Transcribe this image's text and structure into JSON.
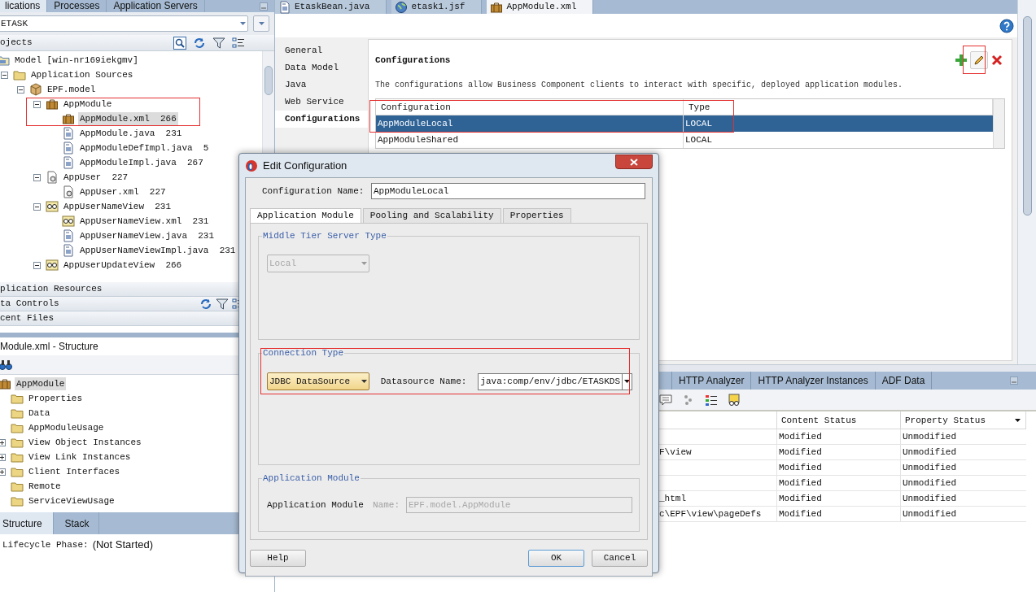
{
  "left_tabs": [
    {
      "label": "lications",
      "selected": true
    },
    {
      "label": "Processes",
      "selected": false
    },
    {
      "label": "Application Servers",
      "selected": false
    }
  ],
  "app_selector": {
    "value": "ETASK"
  },
  "projects_header": {
    "title": "ojects"
  },
  "project_tree": [
    {
      "label": "Model [win-nr169iekgmv]",
      "kind": "project",
      "selected": false,
      "children": [
        {
          "label": "Application Sources",
          "kind": "folder",
          "selected": false,
          "expanded": true,
          "children": [
            {
              "label": "EPF.model",
              "kind": "package",
              "selected": false,
              "expanded": true,
              "children": [
                {
                  "label": "AppModule",
                  "kind": "module",
                  "selected": false,
                  "expanded": true,
                  "children": [
                    {
                      "label": "AppModule.xml",
                      "count": "266",
                      "kind": "module",
                      "selected": true
                    },
                    {
                      "label": "AppModule.java",
                      "count": "231",
                      "kind": "java",
                      "selected": false
                    },
                    {
                      "label": "AppModuleDefImpl.java",
                      "count": "5",
                      "kind": "java",
                      "selected": false
                    },
                    {
                      "label": "AppModuleImpl.java",
                      "count": "267",
                      "kind": "java",
                      "selected": false
                    }
                  ]
                },
                {
                  "label": "AppUser",
                  "count": "227",
                  "kind": "entity",
                  "selected": false,
                  "expanded": true,
                  "children": [
                    {
                      "label": "AppUser.xml",
                      "count": "227",
                      "kind": "entity",
                      "selected": false
                    }
                  ]
                },
                {
                  "label": "AppUserNameView",
                  "count": "231",
                  "kind": "view",
                  "selected": false,
                  "expanded": true,
                  "children": [
                    {
                      "label": "AppUserNameView.xml",
                      "count": "231",
                      "kind": "view",
                      "selected": false
                    },
                    {
                      "label": "AppUserNameView.java",
                      "count": "231",
                      "kind": "java",
                      "selected": false
                    },
                    {
                      "label": "AppUserNameViewImpl.java",
                      "count": "231",
                      "kind": "java",
                      "selected": false
                    }
                  ]
                },
                {
                  "label": "AppUserUpdateView",
                  "count": "266",
                  "kind": "view",
                  "selected": false,
                  "expanded": true
                }
              ]
            }
          ]
        }
      ]
    }
  ],
  "accordion": [
    {
      "label": "plication Resources"
    },
    {
      "label": "ta Controls"
    },
    {
      "label": "cent Files"
    }
  ],
  "structure": {
    "title": "Module.xml - Structure",
    "tree": [
      {
        "label": "AppModule",
        "kind": "module",
        "selected": true,
        "children": [
          {
            "label": "Properties",
            "kind": "folder",
            "selected": false
          },
          {
            "label": "Data",
            "kind": "folder",
            "selected": false
          },
          {
            "label": "AppModuleUsage",
            "kind": "folder",
            "selected": false
          },
          {
            "label": "View Object Instances",
            "kind": "folder",
            "selected": false,
            "expanded": false
          },
          {
            "label": "View Link Instances",
            "kind": "folder",
            "selected": false,
            "expanded": false
          },
          {
            "label": "Client Interfaces",
            "kind": "folder",
            "selected": false,
            "expanded": false
          },
          {
            "label": "Remote",
            "kind": "folder",
            "selected": false
          },
          {
            "label": "ServiceViewUsage",
            "kind": "folder",
            "selected": false
          }
        ]
      }
    ]
  },
  "bottom_tabs": [
    {
      "label": "Structure",
      "selected": true
    },
    {
      "label": "Stack",
      "selected": false
    }
  ],
  "lifecycle": {
    "label": "Lifecycle Phase:",
    "value": "(Not Started)"
  },
  "editor_tabs": [
    {
      "label": "EtaskBean.java",
      "kind": "java",
      "selected": false
    },
    {
      "label": "etask1.jsf",
      "kind": "web",
      "selected": false
    },
    {
      "label": "AppModule.xml",
      "kind": "module",
      "selected": true
    }
  ],
  "editor_nav": [
    {
      "label": "General",
      "selected": false
    },
    {
      "label": "Data Model",
      "selected": false
    },
    {
      "label": "Java",
      "selected": false
    },
    {
      "label": "Web Service",
      "selected": false
    },
    {
      "label": "Configurations",
      "selected": true
    }
  ],
  "configurations": {
    "title": "Configurations",
    "description": "The configurations allow Business Component clients to interact with specific, deployed application modules.",
    "columns": [
      "Configuration",
      "Type"
    ],
    "rows": [
      {
        "cells": [
          "AppModuleLocal",
          "LOCAL"
        ],
        "selected": true
      },
      {
        "cells": [
          "AppModuleShared",
          "LOCAL"
        ],
        "selected": false
      }
    ]
  },
  "log_panel": {
    "tabs": [
      {
        "label": "HTTP Analyzer",
        "selected": false
      },
      {
        "label": "HTTP Analyzer Instances",
        "selected": false
      },
      {
        "label": "ADF Data",
        "selected": false
      }
    ],
    "columns": [
      "Content Status",
      "Property Status"
    ],
    "rows": [
      {
        "content": "Modified",
        "property": "Unmodified"
      },
      {
        "path": "F\\view",
        "content": "Modified",
        "property": "Unmodified"
      },
      {
        "content": "Modified",
        "property": "Unmodified"
      },
      {
        "content": "Modified",
        "property": "Unmodified"
      },
      {
        "path": "_html",
        "content": "Modified",
        "property": "Unmodified"
      },
      {
        "path": "c\\EPF\\view\\pageDefs",
        "content": "Modified",
        "property": "Unmodified"
      }
    ]
  },
  "dialog": {
    "title": "Edit Configuration",
    "config_name": {
      "label": "Configuration Name:",
      "value": "AppModuleLocal"
    },
    "tabs": [
      {
        "label": "Application Module",
        "selected": true
      },
      {
        "label": "Pooling and Scalability",
        "selected": false
      },
      {
        "label": "Properties",
        "selected": false
      }
    ],
    "middle_tier": {
      "title": "Middle Tier Server Type",
      "value": "Local",
      "disabled": true
    },
    "connection": {
      "title": "Connection Type",
      "type_value": "JDBC DataSource",
      "datasource_label": "Datasource Name:",
      "datasource_value": "java:comp/env/jdbc/ETASKDS"
    },
    "app_module": {
      "title": "Application Module",
      "label": "Application Module",
      "name_label": "Name:",
      "value": "EPF.model.AppModule",
      "disabled": true
    },
    "buttons": [
      {
        "label": "Help",
        "default": false
      },
      {
        "label": "OK",
        "default": true
      },
      {
        "label": "Cancel",
        "default": false
      }
    ]
  }
}
